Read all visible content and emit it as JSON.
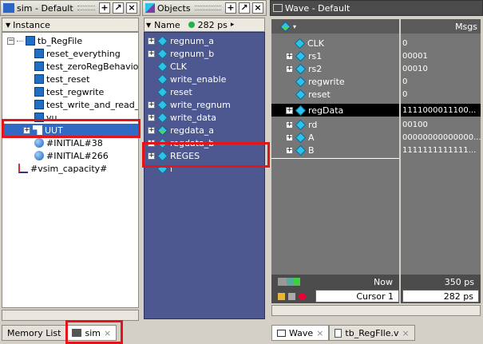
{
  "sim": {
    "title": "sim - Default",
    "column": "Instance",
    "tree": [
      {
        "label": "tb_RegFile",
        "indent": 0,
        "expander": "-",
        "icon": "module"
      },
      {
        "label": "reset_everything",
        "indent": 1,
        "icon": "task"
      },
      {
        "label": "test_zeroRegBehavior",
        "indent": 1,
        "icon": "task"
      },
      {
        "label": "test_reset",
        "indent": 1,
        "icon": "task"
      },
      {
        "label": "test_regwrite",
        "indent": 1,
        "icon": "task"
      },
      {
        "label": "test_write_and_read_",
        "indent": 1,
        "icon": "task"
      },
      {
        "label": "vu",
        "indent": 1,
        "icon": "task"
      },
      {
        "label": "UUT",
        "indent": 1,
        "expander": "+",
        "icon": "module-f",
        "selected": true
      },
      {
        "label": "#INITIAL#38",
        "indent": 1,
        "icon": "process"
      },
      {
        "label": "#INITIAL#266",
        "indent": 1,
        "icon": "process"
      },
      {
        "label": "#vsim_capacity#",
        "indent": 0,
        "icon": "capacity"
      }
    ],
    "tabs": [
      "Memory List",
      "sim"
    ]
  },
  "objects": {
    "title": "Objects",
    "column": "Name",
    "time": "282 ps",
    "items": [
      {
        "label": "regnum_a",
        "expander": true
      },
      {
        "label": "regnum_b",
        "expander": true
      },
      {
        "label": "CLK",
        "expander": false
      },
      {
        "label": "write_enable",
        "expander": false
      },
      {
        "label": "reset",
        "expander": false
      },
      {
        "label": "write_regnum",
        "expander": true
      },
      {
        "label": "write_data",
        "expander": true
      },
      {
        "label": "regdata_a",
        "expander": true,
        "mixed": true
      },
      {
        "label": "regdata_b",
        "expander": true
      },
      {
        "label": "REGES",
        "expander": true
      },
      {
        "label": "i",
        "expander": false
      }
    ]
  },
  "wave": {
    "title": "Wave - Default",
    "msgs_label": "Msgs",
    "signals": [
      {
        "name": "CLK",
        "value": "0",
        "expander": false
      },
      {
        "name": "rs1",
        "value": "00001",
        "expander": true
      },
      {
        "name": "rs2",
        "value": "00010",
        "expander": true
      },
      {
        "name": "regwrite",
        "value": "0",
        "expander": false
      },
      {
        "name": "reset",
        "value": "0",
        "expander": false
      },
      {
        "name": "regData",
        "value": "1111000011100...",
        "expander": true,
        "selected": true
      },
      {
        "name": "rd",
        "value": "00100",
        "expander": true
      },
      {
        "name": "A",
        "value": "00000000000000...",
        "expander": true
      },
      {
        "name": "B",
        "value": "1111111111111...",
        "expander": true
      }
    ],
    "now_label": "Now",
    "now_value": "350 ps",
    "cursor_label": "Cursor 1",
    "cursor_value": "282 ps",
    "tabs": [
      "Wave",
      "tb_RegFIle.v"
    ]
  },
  "colors": {
    "highlight": "#e0161b",
    "objects_bg": "#4d5891",
    "wave_bg": "#767676",
    "selection": "#316ac5"
  }
}
